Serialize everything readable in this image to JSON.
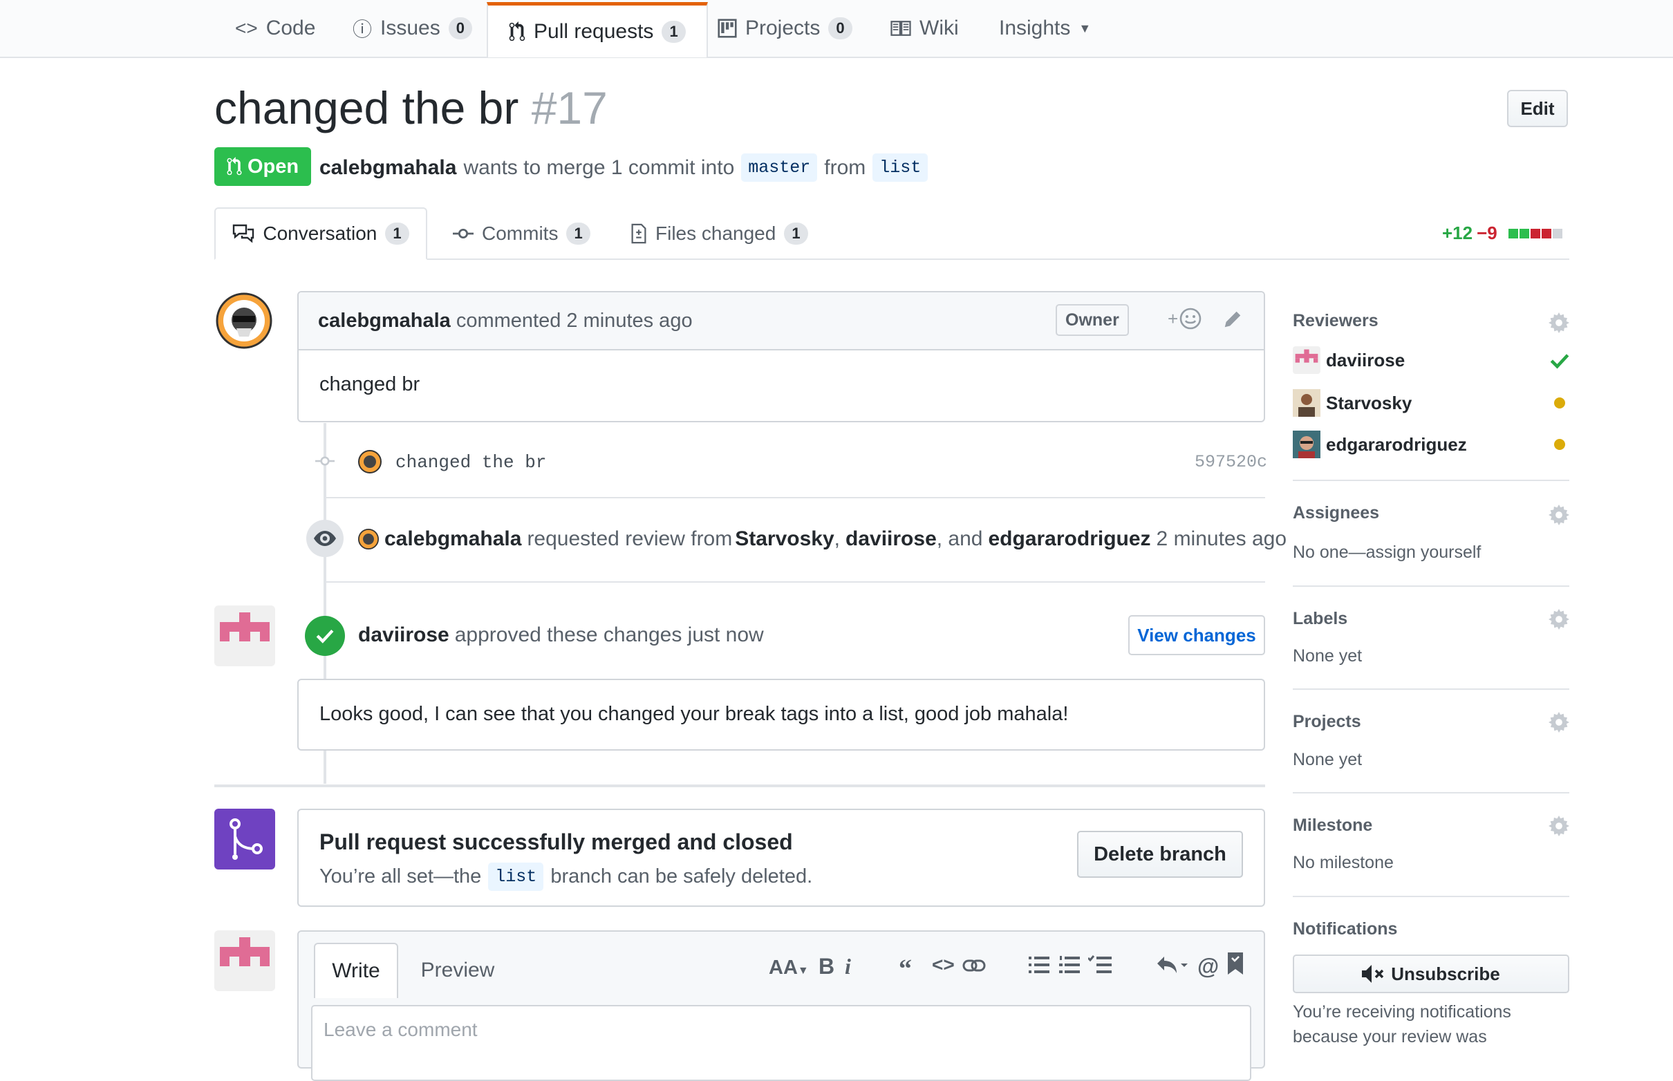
{
  "nav": {
    "tabs": [
      {
        "label": "Code"
      },
      {
        "label": "Issues",
        "count": "0"
      },
      {
        "label": "Pull requests",
        "count": "1"
      },
      {
        "label": "Projects",
        "count": "0"
      },
      {
        "label": "Wiki"
      },
      {
        "label": "Insights"
      }
    ]
  },
  "pr": {
    "title": "changed the br",
    "number": "#17",
    "edit_label": "Edit",
    "state": "Open",
    "author": "calebgmahala",
    "merge_text": "wants to merge 1 commit into",
    "base": "master",
    "from_text": "from",
    "head": "list"
  },
  "pr_tabs": [
    {
      "label": "Conversation",
      "count": "1"
    },
    {
      "label": "Commits",
      "count": "1"
    },
    {
      "label": "Files changed",
      "count": "1"
    }
  ],
  "diffstat": {
    "additions": "+12",
    "deletions": "−9"
  },
  "comment1": {
    "author": "calebgmahala",
    "meta": "commented 2 minutes ago",
    "badge": "Owner",
    "reaction": "+",
    "body": "changed br"
  },
  "commit": {
    "message": "changed the br",
    "sha": "597520c"
  },
  "review_request": {
    "actor": "calebgmahala",
    "text": "requested review from",
    "r1": "Starvosky",
    "sep1": ",",
    "r2": "daviirose",
    "sep2": ", and",
    "r3": "edgararodriguez",
    "time": "2 minutes ago"
  },
  "review": {
    "author": "daviirose",
    "text": "approved these changes just now",
    "view_label": "View changes",
    "body": "Looks good, I can see that you changed your break tags into a list, good job mahala!"
  },
  "merged": {
    "title": "Pull request successfully merged and closed",
    "pre": "You’re all set—the",
    "branch": "list",
    "post": "branch can be safely deleted.",
    "delete_label": "Delete branch"
  },
  "form": {
    "write": "Write",
    "preview": "Preview",
    "toolbar": [
      "AA",
      "B",
      "i"
    ],
    "placeholder": "Leave a comment"
  },
  "sidebar": {
    "reviewers_title": "Reviewers",
    "reviewers": [
      {
        "name": "daviirose",
        "status": "approved"
      },
      {
        "name": "Starvosky",
        "status": "pending"
      },
      {
        "name": "edgararodriguez",
        "status": "pending"
      }
    ],
    "assignees_title": "Assignees",
    "assignees_value": "No one—assign yourself",
    "labels_title": "Labels",
    "labels_value": "None yet",
    "projects_title": "Projects",
    "projects_value": "None yet",
    "milestone_title": "Milestone",
    "milestone_value": "No milestone",
    "notifications_title": "Notifications",
    "unsubscribe_label": "Unsubscribe",
    "notifications_text": "You’re receiving notifications because your review was"
  },
  "colors": {
    "open": "#2cbe4e",
    "merged": "#6f42c1",
    "accent": "#e36209",
    "link": "#0366d6"
  }
}
